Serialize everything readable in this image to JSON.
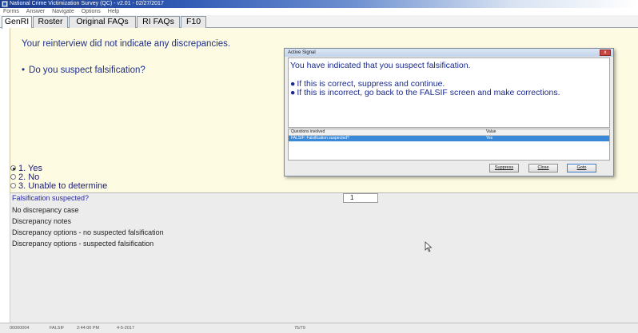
{
  "window": {
    "title": "National Crime Victimization Survey (QC) - v2.01 - 02/27/2017"
  },
  "menu": [
    "Forms",
    "Answer",
    "Navigate",
    "Options",
    "Help"
  ],
  "tabs": [
    "GenRI",
    "Roster",
    "Original FAQs",
    "RI FAQs",
    "F10"
  ],
  "question_panel": {
    "intro": "Your reinterview did not indicate any discrepancies.",
    "bullet": "•",
    "question": "Do you suspect falsification?"
  },
  "answers": [
    {
      "label": "1. Yes",
      "selected": true
    },
    {
      "label": "2. No",
      "selected": false
    },
    {
      "label": "3. Unable to determine",
      "selected": false
    }
  ],
  "fields": [
    {
      "label": "Falsification suspected?",
      "value": "1"
    },
    {
      "label": "No discrepancy case"
    },
    {
      "label": "Discrepancy notes"
    },
    {
      "label": "Discrepancy options - no suspected falsification"
    },
    {
      "label": "Discrepancy options - suspected falsification"
    }
  ],
  "status_bar": [
    "00000004",
    "FALSIF",
    "2:44:00 PM",
    "4-5-2017",
    "75/79"
  ],
  "dialog": {
    "title": "Active Signal",
    "close_label": "x",
    "message": "You have indicated that you suspect falsification.",
    "bullet_dot": "●",
    "bullets": [
      "If this is correct, suppress and continue.",
      "If this is incorrect, go back to the FALSIF screen and make corrections."
    ],
    "table": {
      "headers": [
        "Questions involved",
        "Value"
      ],
      "rows": [
        {
          "question": "FALSIF: Falsification suspected?",
          "value": "Yes"
        }
      ]
    },
    "buttons": {
      "suppress": "Suppress",
      "close": "Close",
      "goto": "Goto"
    }
  },
  "colors": {
    "question_bg": "#fdfbe1",
    "prompt_text": "#1f2e8a",
    "selected_row": "#3a88d8",
    "title_bar": "#2f59b4"
  }
}
